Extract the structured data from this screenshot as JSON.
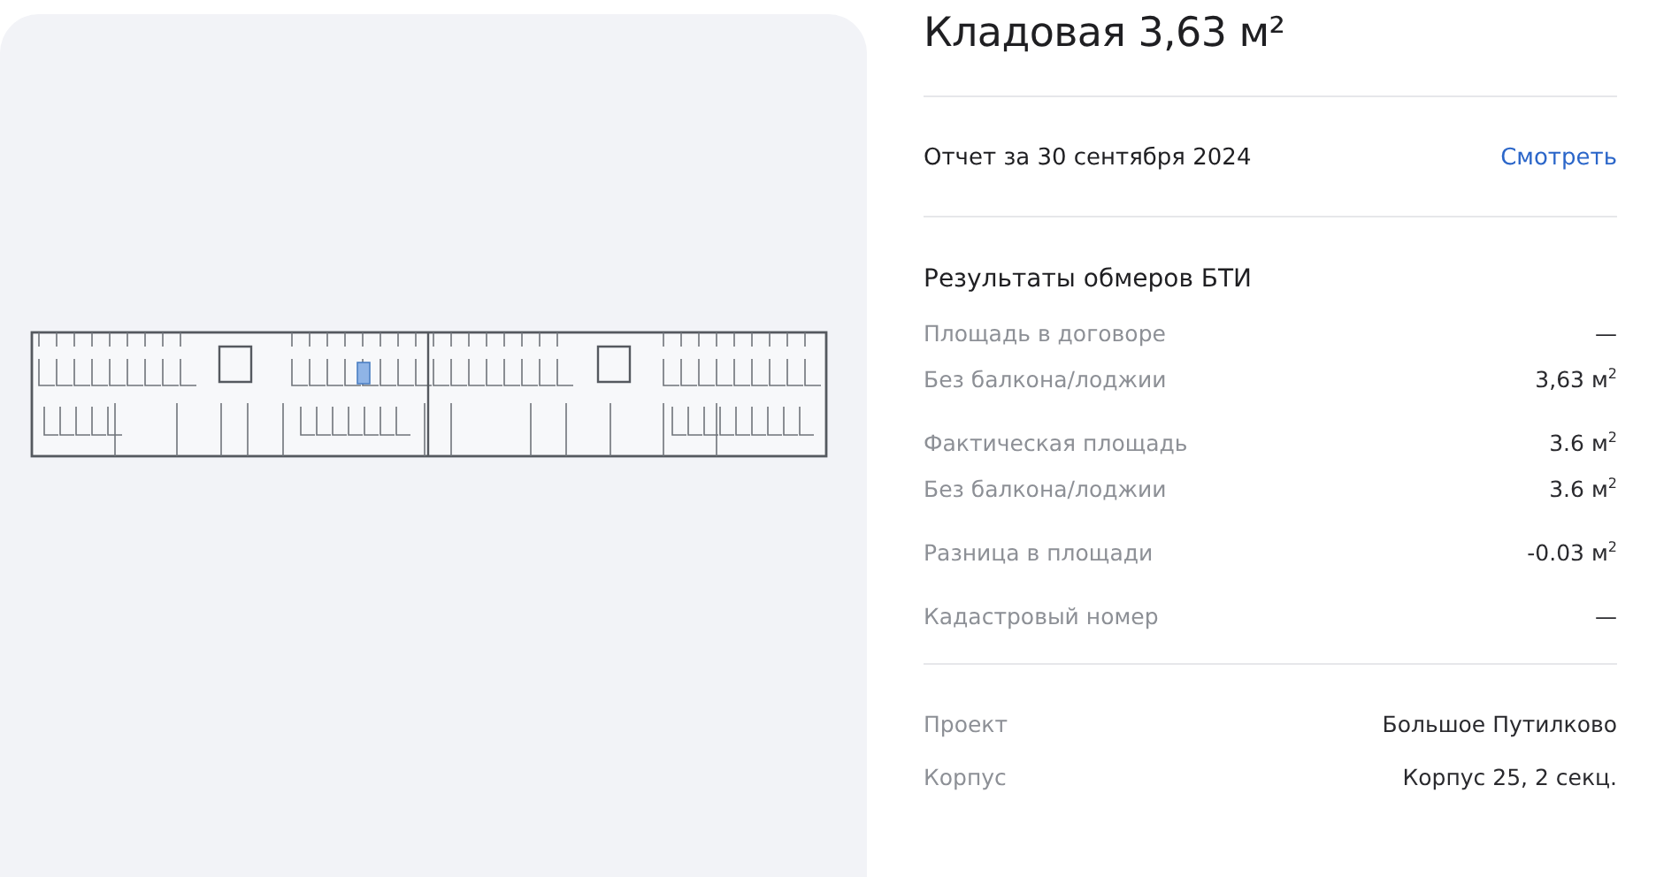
{
  "title": "Кладовая 3,63 м²",
  "report": {
    "label": "Отчет за 30 сентября 2024",
    "link": "Смотреть"
  },
  "measurements": {
    "heading": "Результаты обмеров БТИ",
    "groups": [
      [
        {
          "label": "Площадь в договоре",
          "value": "—"
        },
        {
          "label": "Без балкона/лоджии",
          "value": "3,63 м$^{2}$"
        }
      ],
      [
        {
          "label": "Фактическая площадь",
          "value": "3.6 м$^{2}$"
        },
        {
          "label": "Без балкона/лоджии",
          "value": "3.6 м$^{2}$"
        }
      ],
      [
        {
          "label": "Разница в площади",
          "value": "-0.03 м$^{2}$"
        }
      ],
      [
        {
          "label": "Кадастровый номер",
          "value": "—"
        }
      ]
    ]
  },
  "details": [
    {
      "label": "Проект",
      "value": "Большое Путилково"
    },
    {
      "label": "Корпус",
      "value": "Корпус 25, 2 секц."
    }
  ]
}
